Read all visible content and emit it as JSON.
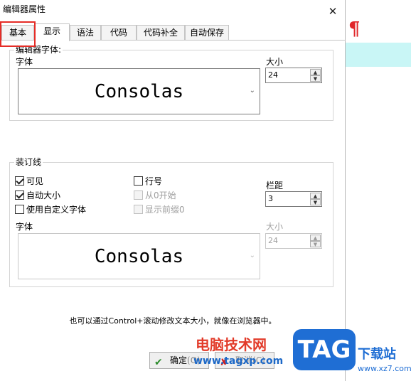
{
  "window": {
    "title": "编辑器属性",
    "close_glyph": "✕"
  },
  "tabs": [
    {
      "label": "基本"
    },
    {
      "label": "显示"
    },
    {
      "label": "语法"
    },
    {
      "label": "代码"
    },
    {
      "label": "代码补全"
    },
    {
      "label": "自动保存"
    }
  ],
  "active_tab": "显示",
  "editor_font_group": {
    "title": "编辑器字体:",
    "font_label": "字体",
    "font_value": "Consolas",
    "size_label": "大小",
    "size_value": "24"
  },
  "gutter_group": {
    "title": "装订线",
    "checkboxes": [
      {
        "label": "可见",
        "checked": true,
        "enabled": true
      },
      {
        "label": "自动大小",
        "checked": true,
        "enabled": true
      },
      {
        "label": "使用自定义字体",
        "checked": false,
        "enabled": true
      },
      {
        "label": "行号",
        "checked": false,
        "enabled": true
      },
      {
        "label": "从0开始",
        "checked": false,
        "enabled": false
      },
      {
        "label": "显示前缀0",
        "checked": false,
        "enabled": false
      }
    ],
    "margin_label": "栏距",
    "margin_value": "3",
    "font_label": "字体",
    "font_value": "Consolas",
    "size_label": "大小",
    "size_value": "24"
  },
  "hint": "也可以通过Control+滚动修改文本大小，就像在浏览器中。",
  "buttons": {
    "ok": "确定",
    "ok_suffix": "(O)",
    "cancel": "取消",
    "cancel_suffix": "(C)"
  },
  "watermark": {
    "cn": "电脑技术网",
    "url": "www.tagxp.com",
    "logo": "TAG",
    "brand": "下载站",
    "brand_url": "www.xz7.com"
  },
  "colors": {
    "highlight_red": "#e52d27",
    "editor_line": "#c9f6f6",
    "pilcrow": "#e0262a",
    "brand_blue": "#1f6ed4"
  }
}
